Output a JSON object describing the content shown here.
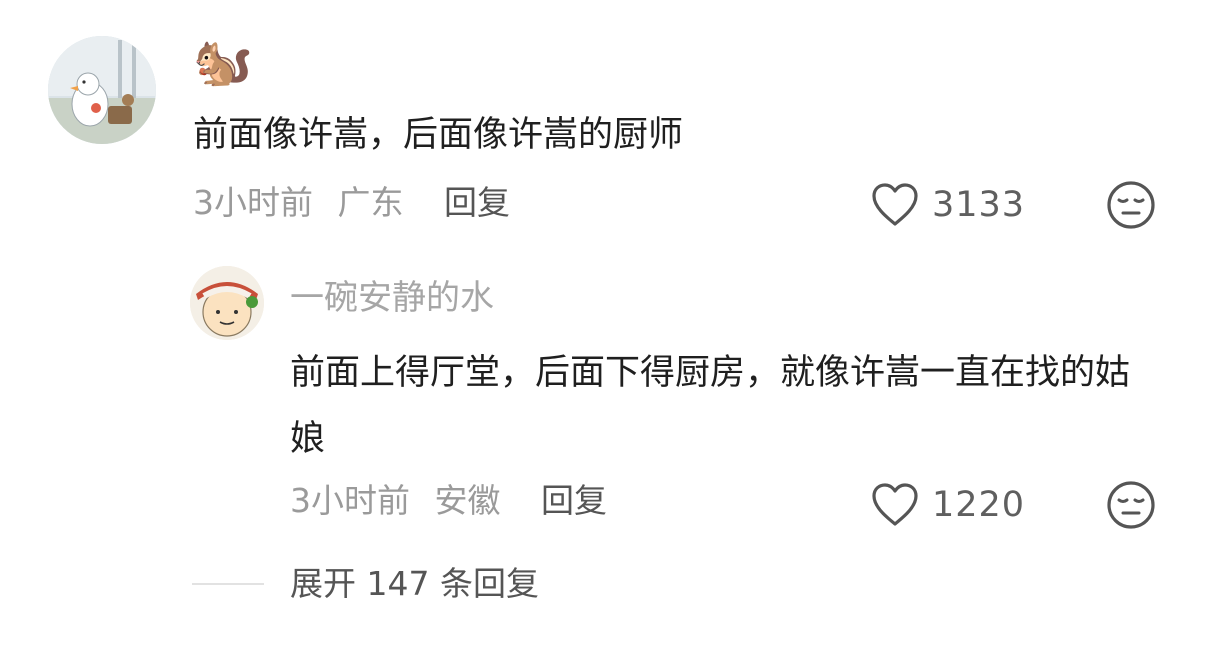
{
  "comment": {
    "username_emoji": "🐿️",
    "text": "前面像许嵩，后面像许嵩的厨师",
    "time": "3小时前",
    "location": "广东",
    "reply_label": "回复",
    "like_count": "3133",
    "like_icon": "heart-outline-icon",
    "dislike_icon": "neutral-face-icon"
  },
  "reply": {
    "username": "一碗安静的水",
    "text": "前面上得厅堂，后面下得厨房，就像许嵩一直在找的姑娘",
    "time": "3小时前",
    "location": "安徽",
    "reply_label": "回复",
    "like_count": "1220",
    "like_icon": "heart-outline-icon",
    "dislike_icon": "neutral-face-icon"
  },
  "expand": {
    "label": "展开 147 条回复"
  },
  "colors": {
    "primary_text": "#1f1f1f",
    "secondary_text": "#9a9a9a",
    "reply_link": "#555555",
    "icon": "#555555",
    "background": "#ffffff"
  }
}
